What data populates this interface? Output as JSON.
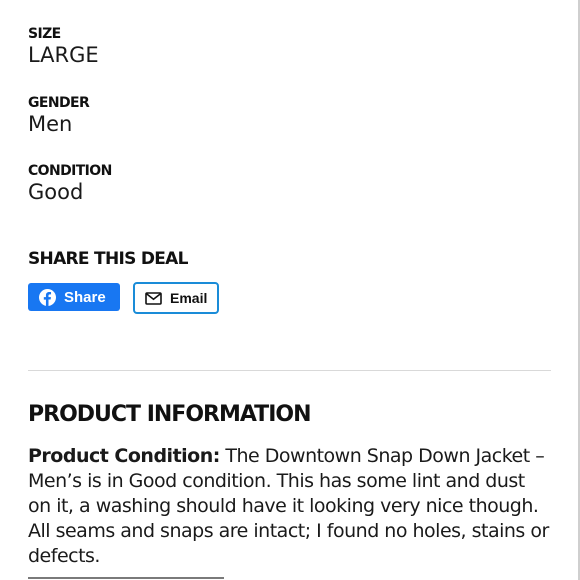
{
  "attributes": [
    {
      "label": "SIZE",
      "value": "LARGE"
    },
    {
      "label": "GENDER",
      "value": "Men"
    },
    {
      "label": "CONDITION",
      "value": "Good"
    }
  ],
  "share": {
    "title": "SHARE THIS DEAL",
    "share_button_label": "Share",
    "share_button_icon": "facebook-icon",
    "share_button_color": "#1877f2",
    "email_button_label": "Email",
    "email_button_icon": "mail-icon",
    "email_button_border": "#1a8cd8"
  },
  "product_information": {
    "title": "PRODUCT INFORMATION",
    "lead": "Product Condition:",
    "body": " The Downtown Snap Down Jacket – Men’s is in Good condition. This has some lint and dust on it, a washing should have it looking very nice though. All seams and snaps are intact; I found no holes, stains or defects."
  }
}
